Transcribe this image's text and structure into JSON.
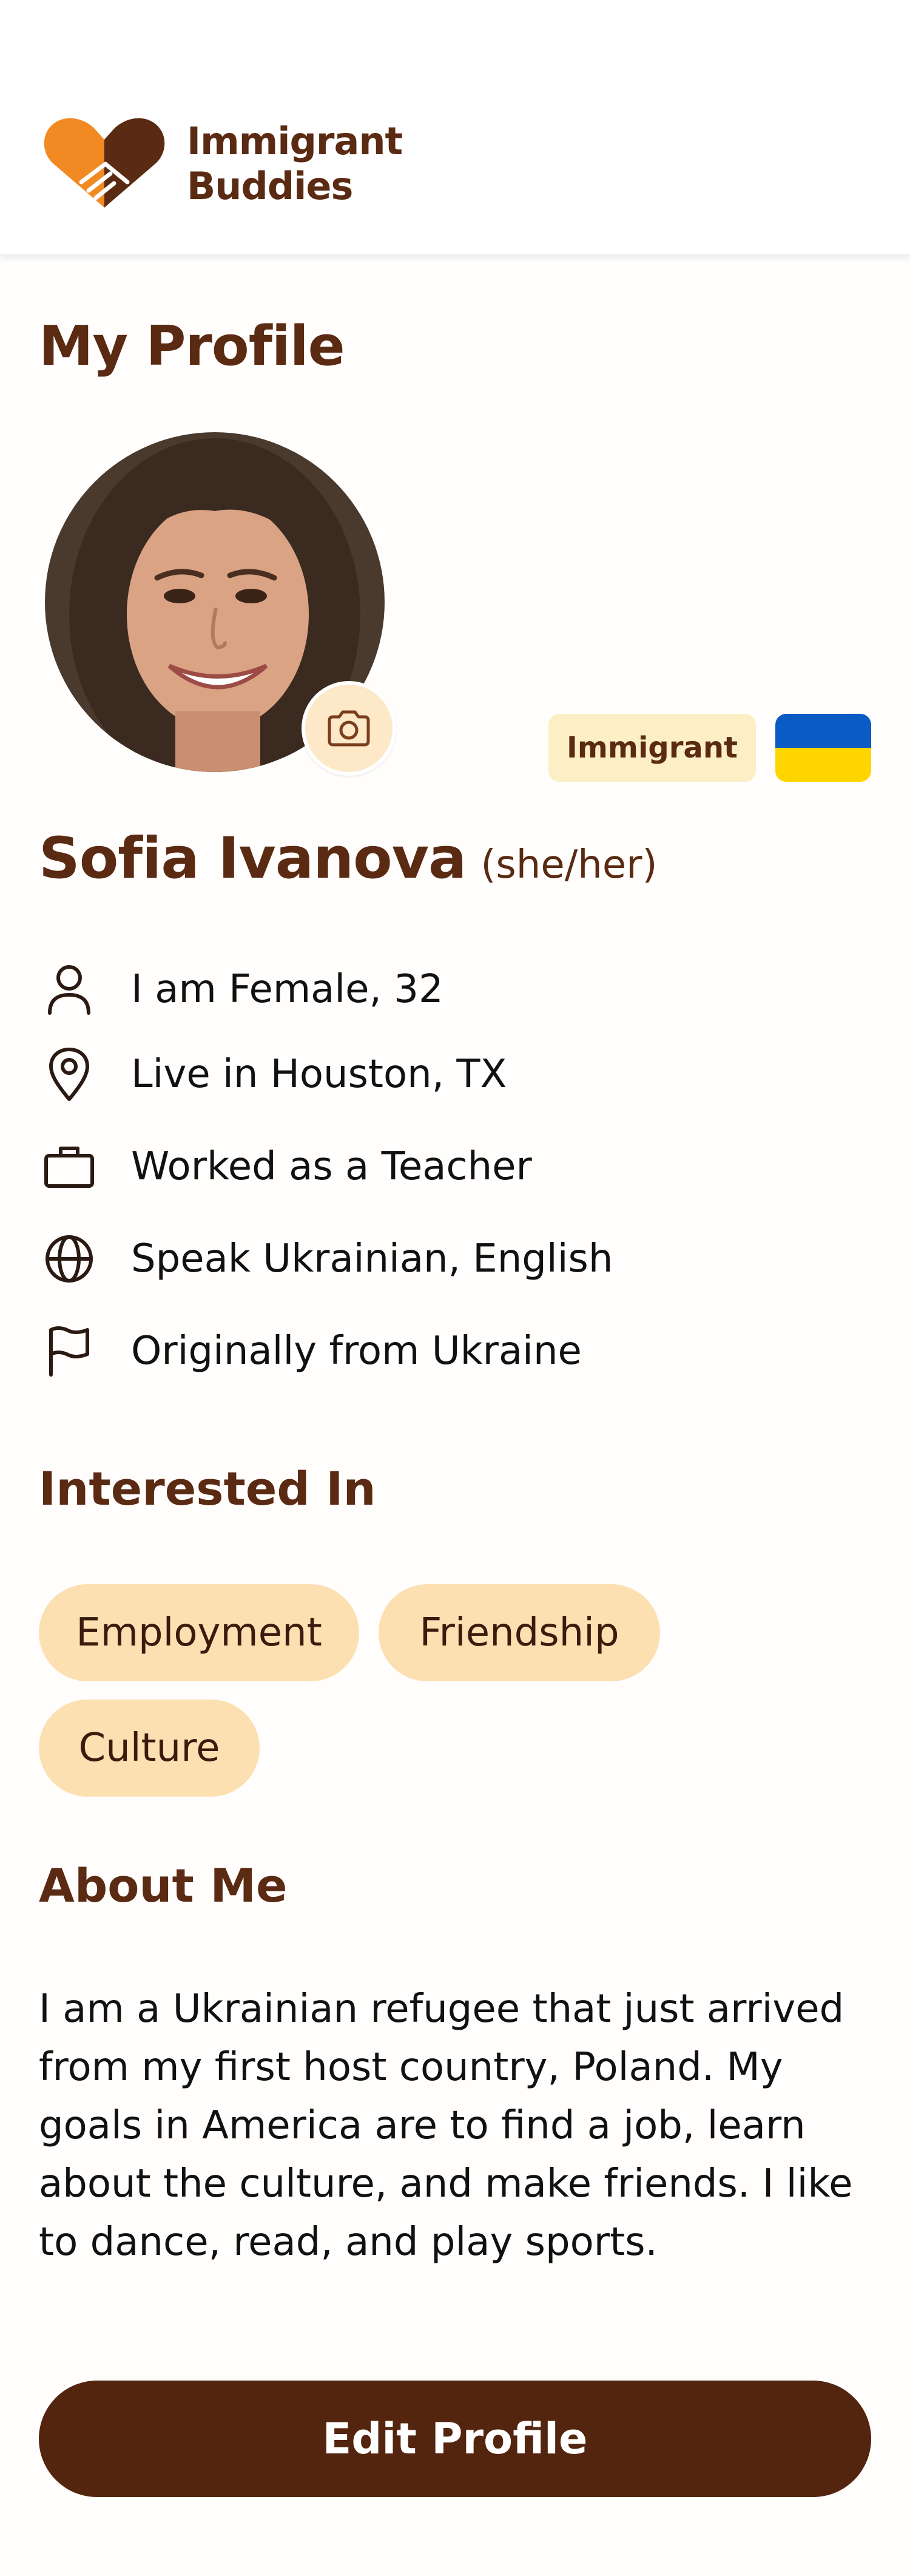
{
  "app": {
    "logo_line1": "Immigrant",
    "logo_line2": "Buddies",
    "logo_icon": "hands-heart-icon"
  },
  "page": {
    "title": "My Profile"
  },
  "profile": {
    "name": "Sofia Ivanova",
    "pronouns": "(she/her)",
    "badge": "Immigrant",
    "flag": "ukraine-flag",
    "avatar_icon": "profile-photo",
    "camera_icon": "camera-icon"
  },
  "info": [
    {
      "icon": "person-icon",
      "text": "I am Female, 32"
    },
    {
      "icon": "location-pin-icon",
      "text": "Live in Houston, TX"
    },
    {
      "icon": "briefcase-icon",
      "text": "Worked as a Teacher"
    },
    {
      "icon": "globe-icon",
      "text": "Speak Ukrainian, English"
    },
    {
      "icon": "flag-icon",
      "text": "Originally from Ukraine"
    }
  ],
  "interests": {
    "title": "Interested In",
    "items": [
      "Employment",
      "Friendship",
      "Culture"
    ]
  },
  "about": {
    "title": "About Me",
    "text": "I am a Ukrainian refugee that just arrived from my first host country, Poland. My goals in America are to find a job, learn about the culture, and make friends. I like to dance, read, and play sports."
  },
  "actions": {
    "edit_label": "Edit Profile"
  },
  "colors": {
    "brand_brown": "#5a2a12",
    "brand_orange": "#f28a24",
    "chip_bg": "#fde0b2",
    "badge_bg": "#fcefc6",
    "flag_blue": "#0a5bc4",
    "flag_yellow": "#ffd500"
  }
}
